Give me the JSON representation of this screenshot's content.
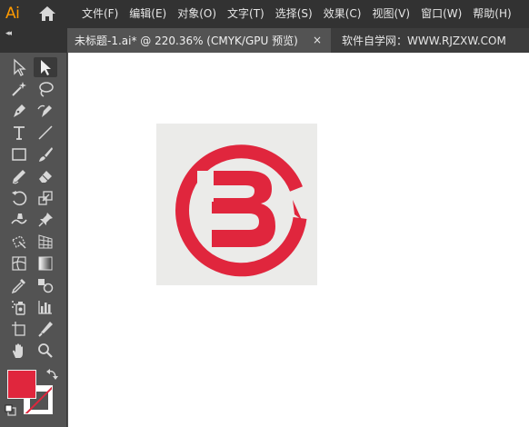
{
  "app": {
    "logo_text": "Ai",
    "brand_color": "#ff9a00"
  },
  "menu": {
    "items": [
      {
        "label": "文件(F)"
      },
      {
        "label": "编辑(E)"
      },
      {
        "label": "对象(O)"
      },
      {
        "label": "文字(T)"
      },
      {
        "label": "选择(S)"
      },
      {
        "label": "效果(C)"
      },
      {
        "label": "视图(V)"
      },
      {
        "label": "窗口(W)"
      },
      {
        "label": "帮助(H)"
      }
    ]
  },
  "tabs": {
    "document_title": "未标题-1.ai* @ 220.36% (CMYK/GPU 预览)",
    "close_glyph": "×",
    "other_title": "软件自学网：WWW.RJZXW.COM"
  },
  "toolbar": {
    "collapse_glyph": "◂◂",
    "tools": [
      {
        "name": "selection-tool",
        "icon": "arrow-outline-icon"
      },
      {
        "name": "direct-selection-tool",
        "icon": "arrow-filled-icon",
        "active": true
      },
      {
        "name": "magic-wand-tool",
        "icon": "magic-wand-icon"
      },
      {
        "name": "lasso-tool",
        "icon": "lasso-icon"
      },
      {
        "name": "pen-tool",
        "icon": "pen-icon"
      },
      {
        "name": "curvature-tool",
        "icon": "curvature-pen-icon"
      },
      {
        "name": "type-tool",
        "icon": "type-icon"
      },
      {
        "name": "line-tool",
        "icon": "line-segment-icon"
      },
      {
        "name": "rectangle-tool",
        "icon": "rectangle-icon"
      },
      {
        "name": "paintbrush-tool",
        "icon": "paintbrush-icon"
      },
      {
        "name": "shaper-tool",
        "icon": "pencil-icon"
      },
      {
        "name": "eraser-tool",
        "icon": "eraser-icon"
      },
      {
        "name": "rotate-tool",
        "icon": "rotate-icon"
      },
      {
        "name": "scale-tool",
        "icon": "scale-icon"
      },
      {
        "name": "warp-tool",
        "icon": "warp-icon"
      },
      {
        "name": "puppet-warp-tool",
        "icon": "pin-icon"
      },
      {
        "name": "free-transform-tool",
        "icon": "free-transform-icon"
      },
      {
        "name": "perspective-grid-tool",
        "icon": "perspective-grid-icon"
      },
      {
        "name": "mesh-tool",
        "icon": "mesh-icon"
      },
      {
        "name": "gradient-tool",
        "icon": "gradient-icon"
      },
      {
        "name": "eyedropper-tool",
        "icon": "eyedropper-icon"
      },
      {
        "name": "blend-tool",
        "icon": "blend-icon"
      },
      {
        "name": "symbol-sprayer-tool",
        "icon": "symbol-sprayer-icon"
      },
      {
        "name": "column-graph-tool",
        "icon": "column-graph-icon"
      },
      {
        "name": "artboard-tool",
        "icon": "artboard-icon"
      },
      {
        "name": "slice-tool",
        "icon": "knife-icon"
      },
      {
        "name": "hand-tool",
        "icon": "hand-icon"
      },
      {
        "name": "zoom-tool",
        "icon": "zoom-icon"
      }
    ],
    "fill_color": "#e0263d",
    "stroke_color": "none"
  },
  "artwork": {
    "background_color": "#ebebe9",
    "logo_color": "#e0263d",
    "description_icon": "letter-b-circle-logo"
  }
}
